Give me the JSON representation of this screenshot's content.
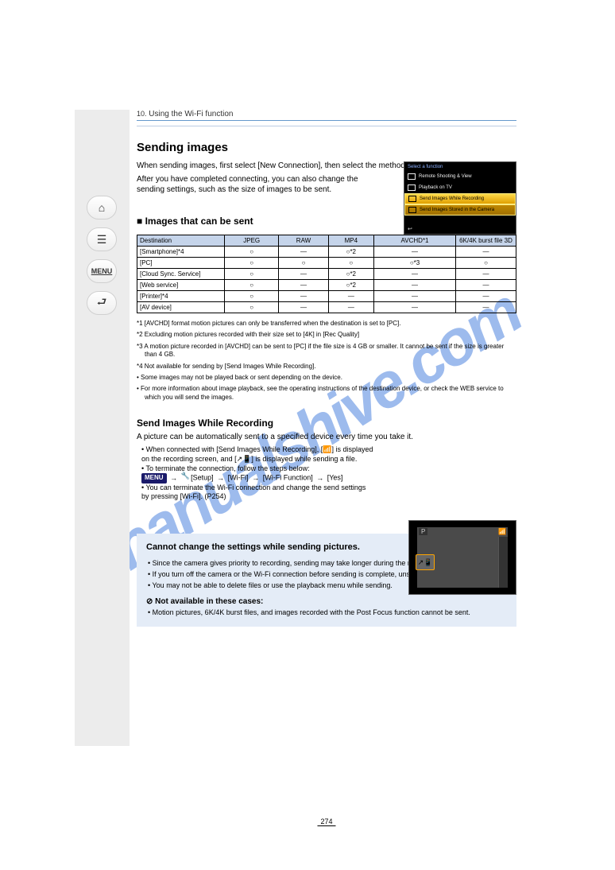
{
  "header": {
    "num": "10.",
    "title": "Using the Wi-Fi function"
  },
  "nav": {
    "menu": "MENU"
  },
  "section": {
    "title": "Sending images",
    "intro1": "When sending images, first select [New Connection], then select the method of sending images.",
    "intro2": "After you have completed connecting, you can also change the sending settings, such as the size of images to be sent."
  },
  "ss1": {
    "title": "Select a function",
    "r1": "Remote Shooting & View",
    "r2": "Playback on TV",
    "r3": "Send Images While Recording",
    "r4": "Send Images Stored in the Camera",
    "back": "↩"
  },
  "table_heading": "Images that can be sent",
  "thead": {
    "dest": "Destination",
    "jpeg": "JPEG",
    "raw": "RAW",
    "mp4": "MP4",
    "avchd": "AVCHD*1",
    "six3d": "6K/4K burst file 3D"
  },
  "trows": [
    {
      "dest": "[Smartphone]*4",
      "jpeg": "○",
      "raw": "—",
      "mp4": "○*2",
      "avchd": "—",
      "six3d": "—"
    },
    {
      "dest": "[PC]",
      "jpeg": "○",
      "raw": "○",
      "mp4": "○",
      "avchd": "○*3",
      "six3d": "○"
    },
    {
      "dest": "[Cloud Sync. Service]",
      "jpeg": "○",
      "raw": "—",
      "mp4": "○*2",
      "avchd": "—",
      "six3d": "—"
    },
    {
      "dest": "[Web service]",
      "jpeg": "○",
      "raw": "—",
      "mp4": "○*2",
      "avchd": "—",
      "six3d": "—"
    },
    {
      "dest": "[Printer]*4",
      "jpeg": "○",
      "raw": "—",
      "mp4": "—",
      "avchd": "—",
      "six3d": "—"
    },
    {
      "dest": "[AV device]",
      "jpeg": "○",
      "raw": "—",
      "mp4": "—",
      "avchd": "—",
      "six3d": "—"
    }
  ],
  "notes": {
    "n1": "*1 [AVCHD] format motion pictures can only be transferred when the destination is set to [PC].",
    "n2": "*2 Excluding motion pictures recorded with their size set to [4K] in [Rec Quality]",
    "n3": "*3 A motion picture recorded in [AVCHD] can be sent to [PC] if the file size is 4 GB or smaller. It cannot be sent if the size is greater than 4 GB.",
    "n4": "*4 Not available for sending by [Send Images While Recording].",
    "bullet1": "Some images may not be played back or sent depending on the device.",
    "bullet2": "For more information about image playback, see the operating instructions of the destination device, or check the WEB service to which you will send the images."
  },
  "sub": {
    "heading": "Send Images While Recording",
    "desc": "A picture can be automatically sent to a specified device every time you take it.",
    "step1": "When connected with [Send Images While Recording], [ ] is displayed on the recording screen, and [ ] is displayed while sending a file.",
    "step2a": "To terminate the connection, follow the steps below:",
    "step2b_parts": {
      "wifi": "[Setup]",
      "item": "[Wi-Fi]",
      "wf": "[Wi-Fi Function]",
      "yes": "[Yes]"
    },
    "step3": "You can terminate the Wi-Fi connection and change the send settings by pressing [Wi-Fi]. (P254)"
  },
  "ss2": {
    "mode": "P"
  },
  "tip": {
    "title": "Cannot change the settings while sending pictures.",
    "li1": "Since the camera gives priority to recording, sending may take longer during the recording.",
    "li2": "If you turn off the camera or the Wi-Fi connection before sending is complete, unsent pictures will not be resent.",
    "li3": "You may not be able to delete files or use the playback menu while sending.",
    "available": "Not available in these cases:",
    "na": "Motion pictures, 6K/4K burst files, and images recorded with the Post Focus function cannot be sent."
  },
  "page_number": "274",
  "watermark": "manualshive.com"
}
